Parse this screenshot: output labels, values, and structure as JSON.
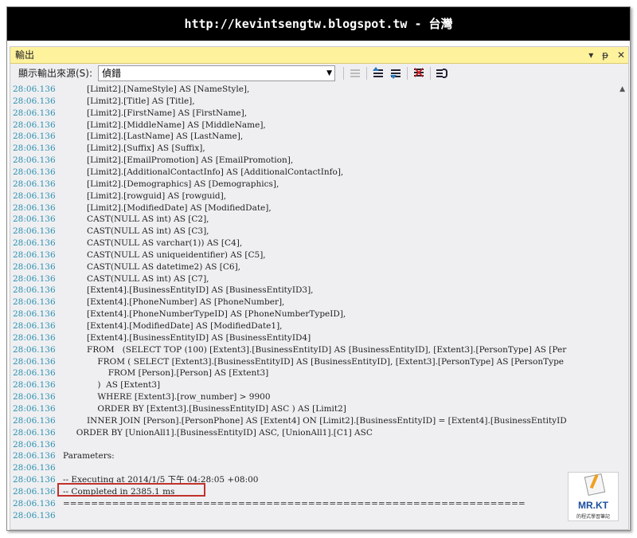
{
  "banner": {
    "text": "http://kevintsengtw.blogspot.tw - 台灣"
  },
  "window": {
    "title": "輸出",
    "controls": {
      "dropdown": "▾",
      "pin": "ᵽ",
      "close": "✕"
    }
  },
  "toolbar": {
    "source_label": "顯示輸出來源(S):",
    "source_value": "偵錯"
  },
  "output_lines": [
    {
      "ts": "28:06.136",
      "text": "         [Limit2].[NameStyle] AS [NameStyle],"
    },
    {
      "ts": "28:06.136",
      "text": "         [Limit2].[Title] AS [Title],"
    },
    {
      "ts": "28:06.136",
      "text": "         [Limit2].[FirstName] AS [FirstName],"
    },
    {
      "ts": "28:06.136",
      "text": "         [Limit2].[MiddleName] AS [MiddleName],"
    },
    {
      "ts": "28:06.136",
      "text": "         [Limit2].[LastName] AS [LastName],"
    },
    {
      "ts": "28:06.136",
      "text": "         [Limit2].[Suffix] AS [Suffix],"
    },
    {
      "ts": "28:06.136",
      "text": "         [Limit2].[EmailPromotion] AS [EmailPromotion],"
    },
    {
      "ts": "28:06.136",
      "text": "         [Limit2].[AdditionalContactInfo] AS [AdditionalContactInfo],"
    },
    {
      "ts": "28:06.136",
      "text": "         [Limit2].[Demographics] AS [Demographics],"
    },
    {
      "ts": "28:06.136",
      "text": "         [Limit2].[rowguid] AS [rowguid],"
    },
    {
      "ts": "28:06.136",
      "text": "         [Limit2].[ModifiedDate] AS [ModifiedDate],"
    },
    {
      "ts": "28:06.136",
      "text": "         CAST(NULL AS int) AS [C2],"
    },
    {
      "ts": "28:06.136",
      "text": "         CAST(NULL AS int) AS [C3],"
    },
    {
      "ts": "28:06.136",
      "text": "         CAST(NULL AS varchar(1)) AS [C4],"
    },
    {
      "ts": "28:06.136",
      "text": "         CAST(NULL AS uniqueidentifier) AS [C5],"
    },
    {
      "ts": "28:06.136",
      "text": "         CAST(NULL AS datetime2) AS [C6],"
    },
    {
      "ts": "28:06.136",
      "text": "         CAST(NULL AS int) AS [C7],"
    },
    {
      "ts": "28:06.136",
      "text": "         [Extent4].[BusinessEntityID] AS [BusinessEntityID3],"
    },
    {
      "ts": "28:06.136",
      "text": "         [Extent4].[PhoneNumber] AS [PhoneNumber],"
    },
    {
      "ts": "28:06.136",
      "text": "         [Extent4].[PhoneNumberTypeID] AS [PhoneNumberTypeID],"
    },
    {
      "ts": "28:06.136",
      "text": "         [Extent4].[ModifiedDate] AS [ModifiedDate1],"
    },
    {
      "ts": "28:06.136",
      "text": "         [Extent4].[BusinessEntityID] AS [BusinessEntityID4]"
    },
    {
      "ts": "28:06.136",
      "text": "         FROM   (SELECT TOP (100) [Extent3].[BusinessEntityID] AS [BusinessEntityID], [Extent3].[PersonType] AS [Per"
    },
    {
      "ts": "28:06.136",
      "text": "             FROM ( SELECT [Extent3].[BusinessEntityID] AS [BusinessEntityID], [Extent3].[PersonType] AS [PersonType"
    },
    {
      "ts": "28:06.136",
      "text": "                 FROM [Person].[Person] AS [Extent3]"
    },
    {
      "ts": "28:06.136",
      "text": "             )  AS [Extent3]"
    },
    {
      "ts": "28:06.136",
      "text": "             WHERE [Extent3].[row_number] > 9900"
    },
    {
      "ts": "28:06.136",
      "text": "             ORDER BY [Extent3].[BusinessEntityID] ASC ) AS [Limit2]"
    },
    {
      "ts": "28:06.136",
      "text": "         INNER JOIN [Person].[PersonPhone] AS [Extent4] ON [Limit2].[BusinessEntityID] = [Extent4].[BusinessEntityID"
    },
    {
      "ts": "28:06.136",
      "text": "     ORDER BY [UnionAll1].[BusinessEntityID] ASC, [UnionAll1].[C1] ASC"
    },
    {
      "ts": "28:06.136",
      "text": ""
    },
    {
      "ts": "28:06.136",
      "text": "Parameters:"
    },
    {
      "ts": "28:06.136",
      "text": ""
    },
    {
      "ts": "28:06.136",
      "text": "-- Executing at 2014/1/5 下午 04:28:05 +08:00"
    },
    {
      "ts": "28:06.136",
      "text": "-- Completed in 2385.1 ms"
    },
    {
      "ts": "28:06.136",
      "text": "=================================================================="
    },
    {
      "ts": "28:06.136",
      "text": ""
    }
  ],
  "watermark": {
    "brand": "MR.KT",
    "tagline": "的程式學習筆記"
  },
  "colors": {
    "timestamp": "#2b91af",
    "titlebar": "#fff29d",
    "highlight": "#c0312b"
  }
}
